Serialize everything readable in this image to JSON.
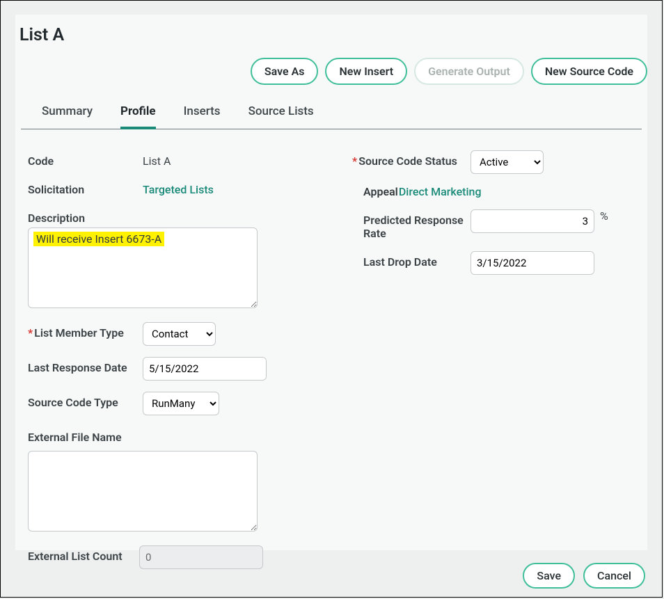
{
  "header": {
    "title": "List A"
  },
  "actions": {
    "save_as": "Save As",
    "new_insert": "New Insert",
    "generate_output": "Generate Output",
    "new_source_code": "New Source Code"
  },
  "tabs": {
    "summary": "Summary",
    "profile": "Profile",
    "inserts": "Inserts",
    "source_lists": "Source Lists"
  },
  "left": {
    "code_label": "Code",
    "code_value": "List A",
    "solicitation_label": "Solicitation",
    "solicitation_link": "Targeted Lists",
    "description_label": "Description",
    "description_value": "Will receive Insert 6673-A",
    "list_member_type_label": "List Member Type",
    "list_member_type_value": "Contact",
    "last_response_date_label": "Last Response Date",
    "last_response_date_value": "5/15/2022",
    "source_code_type_label": "Source Code Type",
    "source_code_type_value": "RunMany",
    "external_file_name_label": "External File Name",
    "external_file_name_value": "",
    "external_list_count_label": "External List Count",
    "external_list_count_value": "0"
  },
  "right": {
    "source_code_status_label": "Source Code Status",
    "source_code_status_value": "Active",
    "appeal_label": "Appeal",
    "appeal_link": "Direct Marketing",
    "predicted_rate_label": "Predicted Response Rate",
    "predicted_rate_value": "3",
    "predicted_rate_unit": "%",
    "last_drop_date_label": "Last Drop Date",
    "last_drop_date_value": "3/15/2022"
  },
  "footer": {
    "save": "Save",
    "cancel": "Cancel"
  }
}
